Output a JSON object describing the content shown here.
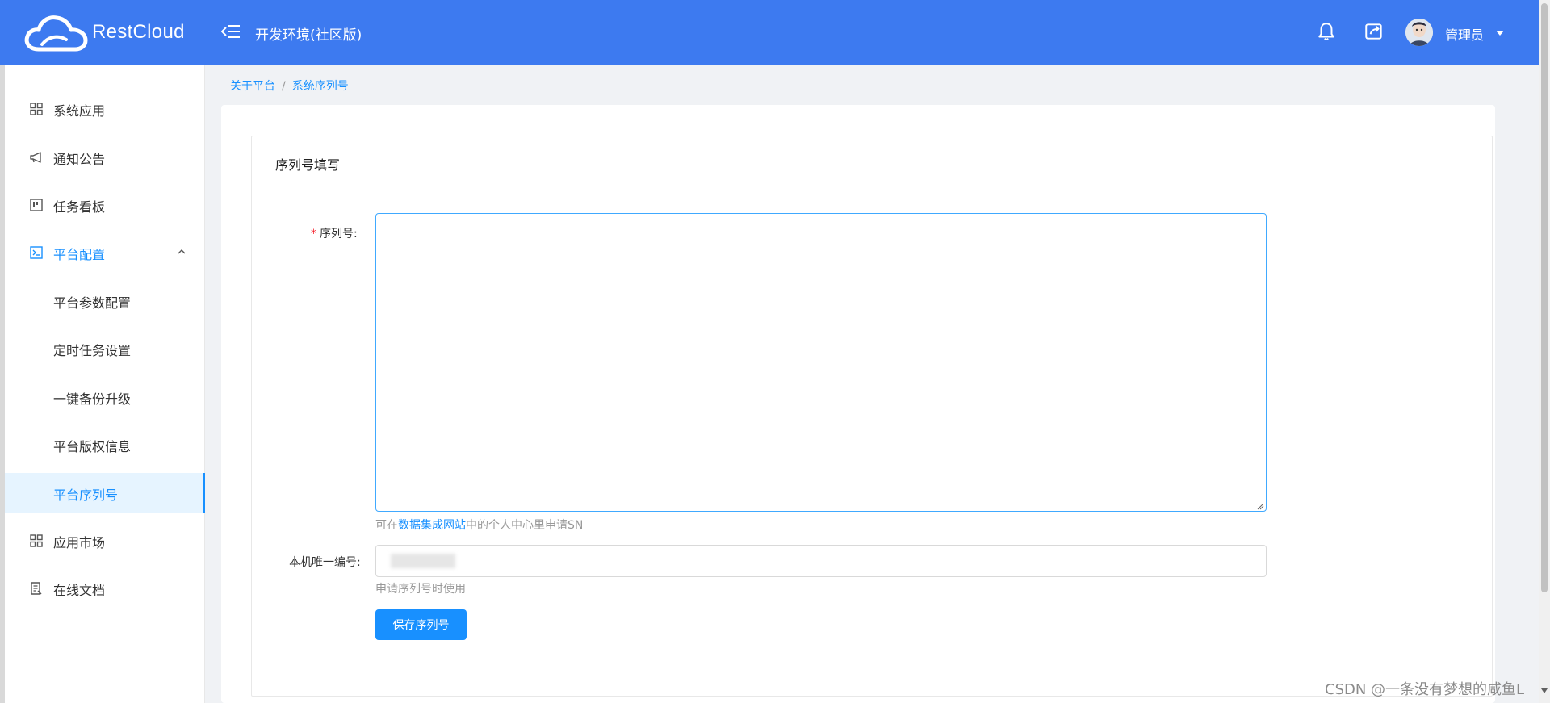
{
  "header": {
    "brand": "RestCloud",
    "env_title": "开发环境(社区版)",
    "user_name": "管理员",
    "colors": {
      "header_bg": "#3d7af0",
      "accent": "#1890ff"
    }
  },
  "sidebar": {
    "items": [
      {
        "label": "系统应用",
        "icon": "grid-icon"
      },
      {
        "label": "通知公告",
        "icon": "megaphone-icon"
      },
      {
        "label": "任务看板",
        "icon": "kanban-icon"
      },
      {
        "label": "平台配置",
        "icon": "terminal-icon",
        "expanded": true
      },
      {
        "label": "应用市场",
        "icon": "grid-icon"
      },
      {
        "label": "在线文档",
        "icon": "document-icon"
      }
    ],
    "sub_items": [
      {
        "label": "平台参数配置"
      },
      {
        "label": "定时任务设置"
      },
      {
        "label": "一键备份升级"
      },
      {
        "label": "平台版权信息"
      },
      {
        "label": "平台序列号",
        "active": true
      }
    ]
  },
  "breadcrumb": {
    "parent": "关于平台",
    "separator": "/",
    "current": "系统序列号"
  },
  "panel": {
    "title": "序列号填写"
  },
  "form": {
    "serial_label": "序列号",
    "serial_required_mark": "*",
    "colon": ":",
    "serial_value": "",
    "serial_help_prefix": "可在",
    "serial_help_link": "数据集成网站",
    "serial_help_suffix": "中的个人中心里申请SN",
    "machine_label": "本机唯一编号",
    "machine_help": "申请序列号时使用",
    "save_button": "保存序列号"
  },
  "watermark": "CSDN @一条没有梦想的咸鱼L"
}
